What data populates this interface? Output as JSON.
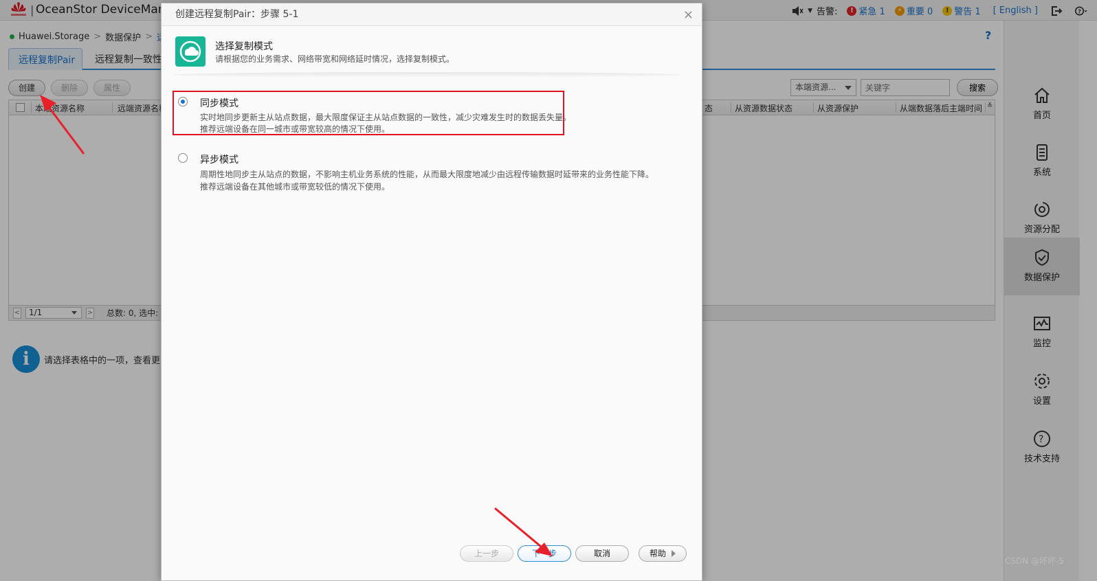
{
  "app": {
    "title": "OceanStor DeviceManager",
    "logo_sep": "|"
  },
  "topbar": {
    "alarm_label": "告警:",
    "critical": "紧急 1",
    "major": "重要 0",
    "warning": "警告 1",
    "language": "[ English ]",
    "colors": {
      "critical": "#e02424",
      "major": "#f39800",
      "warning": "#f5c400"
    }
  },
  "breadcrumb": {
    "device": "Huawei.Storage",
    "section": "数据保护",
    "current": "远程"
  },
  "tabs": [
    {
      "label": "远程复制Pair"
    },
    {
      "label": "远程复制一致性"
    }
  ],
  "toolbar": {
    "create": "创建",
    "delete": "删除",
    "properties": "属性"
  },
  "search": {
    "select_value": "本端资源...",
    "placeholder": "关键字",
    "button": "搜索"
  },
  "grid": {
    "columns": [
      "本端资源名称",
      "远端资源名称",
      "态",
      "从资源数据状态",
      "从资源保护",
      "从端数据落后主端时间"
    ],
    "page": "1/1",
    "total": "总数: 0, 选中:"
  },
  "info_text": "请选择表格中的一项，查看更多",
  "nav": [
    {
      "label": "首页"
    },
    {
      "label": "系统"
    },
    {
      "label": "资源分配"
    },
    {
      "label": "数据保护"
    },
    {
      "label": "监控"
    },
    {
      "label": "设置"
    },
    {
      "label": "技术支持"
    }
  ],
  "dialog": {
    "title": "创建远程复制Pair：步骤 5-1",
    "close": "×",
    "step_title": "选择复制模式",
    "step_desc": "请根据您的业务需求、网络带宽和网络延时情况，选择复制模式。",
    "options": [
      {
        "title": "同步模式",
        "selected": true,
        "line1": "实时地同步更新主从站点数据，最大限度保证主从站点数据的一致性，减少灾难发生时的数据丢失量。",
        "line2": "推荐远端设备在同一城市或带宽较高的情况下使用。"
      },
      {
        "title": "异步模式",
        "selected": false,
        "line1": "周期性地同步主从站点的数据，不影响主机业务系统的性能，从而最大限度地减少由远程传输数据时延带来的业务性能下降。",
        "line2": "推荐远端设备在其他城市或带宽较低的情况下使用。"
      }
    ],
    "buttons": {
      "prev": "上一步",
      "next": "下一步",
      "cancel": "取消",
      "help": "帮助"
    }
  },
  "watermark": "CSDN @坏坏-5",
  "annotation_color": "#e8202a"
}
